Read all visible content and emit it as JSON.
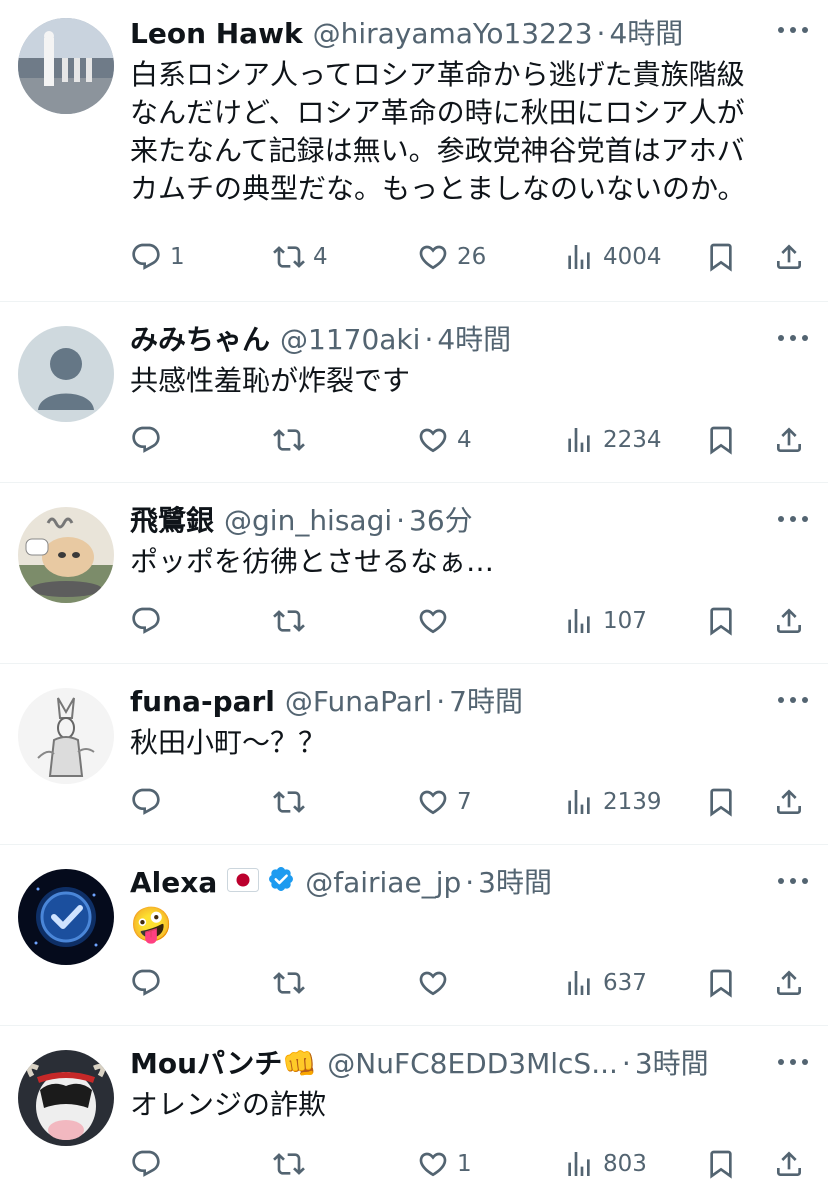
{
  "tweets": [
    {
      "name": "Leon Hawk",
      "handle": "@hirayamaYo13223",
      "dot": "·",
      "time": "4時間",
      "text": "白系ロシア人ってロシア革命から逃げた貴族階級\nなんだけど、ロシア革命の時に秋田にロシア人が\n来たなんて記録は無い。参政党神谷党首はアホバ\nカムチの典型だな。もっとましなのいないのか。",
      "replies": "1",
      "retweets": "4",
      "likes": "26",
      "views": "4004"
    },
    {
      "name": "みみちゃん",
      "handle": "@1170aki",
      "dot": "·",
      "time": "4時間",
      "text": "共感性羞恥が炸裂です",
      "replies": "",
      "retweets": "",
      "likes": "4",
      "views": "2234"
    },
    {
      "name": "飛鷺銀",
      "handle": "@gin_hisagi",
      "dot": "·",
      "time": "36分",
      "text": "ポッポを彷彿とさせるなぁ…",
      "replies": "",
      "retweets": "",
      "likes": "",
      "views": "107"
    },
    {
      "name": "funa-parl",
      "handle": "@FunaParl",
      "dot": "·",
      "time": "7時間",
      "text": "秋田小町〜？？",
      "replies": "",
      "retweets": "",
      "likes": "7",
      "views": "2139"
    },
    {
      "name": "Alexa",
      "name_flag": "🇯🇵",
      "handle": "@fairiae_jp",
      "dot": "·",
      "time": "3時間",
      "text": "🤪",
      "replies": "",
      "retweets": "",
      "likes": "",
      "views": "637"
    },
    {
      "name": "Mouパンチ👊",
      "handle": "@NuFC8EDD3MlcS...",
      "dot": "·",
      "time": "3時間",
      "text": "オレンジの詐欺",
      "replies": "",
      "retweets": "",
      "likes": "1",
      "views": "803"
    }
  ],
  "icons": {
    "reply": "reply-icon",
    "retweet": "retweet-icon",
    "like": "heart-icon",
    "views": "views-icon",
    "bookmark": "bookmark-icon",
    "share": "share-icon",
    "more": "more-icon",
    "verified": "verified-badge-icon"
  },
  "colors": {
    "text": "#0f1419",
    "secondary": "#536471",
    "divider": "#eff3f4",
    "verified": "#1d9bf0"
  }
}
